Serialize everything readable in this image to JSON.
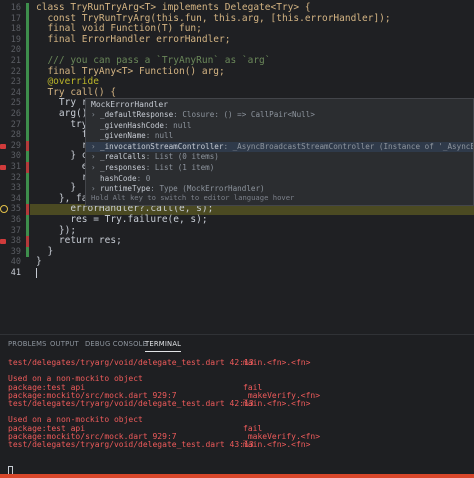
{
  "editor": {
    "lines": [
      {
        "n": "16",
        "text": "class TryRunTryArg<T> implements Delegate<Try> {"
      },
      {
        "n": "17",
        "text": "  const TryRunTryArg(this.fun, this.arg, [this.errorHandler]);"
      },
      {
        "n": "18",
        "text": "  final void Function(T) fun;"
      },
      {
        "n": "19",
        "text": "  final ErrorHandler errorHandler;"
      },
      {
        "n": "20",
        "text": ""
      },
      {
        "n": "21",
        "text": "  /// you can pass a `TryAnyRun` as `arg`"
      },
      {
        "n": "22",
        "text": "  final TryAny<T> Function() arg;"
      },
      {
        "n": "23",
        "text": "  @override"
      },
      {
        "n": "24",
        "text": "  Try call() {"
      },
      {
        "n": "25",
        "text": "    Try re"
      },
      {
        "n": "26",
        "text": "    arg()."
      },
      {
        "n": "27",
        "text": "      try"
      },
      {
        "n": "28",
        "text": "        fu"
      },
      {
        "n": "29",
        "text": "        re"
      },
      {
        "n": "30",
        "text": "      } ca"
      },
      {
        "n": "31",
        "text": "        er"
      },
      {
        "n": "32",
        "text": "        re"
      },
      {
        "n": "33",
        "text": "      }"
      },
      {
        "n": "34",
        "text": "    }, fai"
      },
      {
        "n": "35",
        "text": "      errorHandler?.call(e, s);"
      },
      {
        "n": "36",
        "text": "      res = Try.failure(e, s);"
      },
      {
        "n": "37",
        "text": "    });"
      },
      {
        "n": "38",
        "text": "    return res;"
      },
      {
        "n": "39",
        "text": "  }"
      },
      {
        "n": "40",
        "text": "}"
      },
      {
        "n": "41",
        "text": ""
      }
    ]
  },
  "popup": {
    "title": "MockErrorHandler",
    "rows": [
      {
        "key": "_defaultResponse",
        "value": "Closure: () => CallPair<Null>",
        "arrow": true
      },
      {
        "key": "_givenHashCode",
        "value": "null",
        "arrow": false
      },
      {
        "key": "_givenName",
        "value": "null",
        "arrow": false
      },
      {
        "key": "_invocationStreamController",
        "value": "_AsyncBroadcastStreamController (Instance of '_AsyncBroadcastStreamController",
        "arrow": true
      },
      {
        "key": "_realCalls",
        "value": "List (0 items)",
        "arrow": true
      },
      {
        "key": "_responses",
        "value": "List (1 item)",
        "arrow": true
      },
      {
        "key": "hashCode",
        "value": "0",
        "arrow": false
      },
      {
        "key": "runtimeType",
        "value": "Type (MockErrorHandler)",
        "arrow": true
      }
    ],
    "hint": "Hold Alt key to switch to editor language hover"
  },
  "panel": {
    "tabs": [
      "PROBLEMS",
      "OUTPUT",
      "DEBUG CONSOLE",
      "TERMINAL"
    ],
    "active_tab": "TERMINAL",
    "terminal": [
      {
        "left": "test/delegates/tryarg/void/delegate_test.dart 42:13",
        "right": "main.<fn>.<fn>"
      },
      {
        "left": "",
        "right": ""
      },
      {
        "left": "Used on a non-mockito object",
        "right": ""
      },
      {
        "left": "package:test api",
        "right": "fail"
      },
      {
        "left": "package:mockito/src/mock.dart 929:7",
        "right": "_makeVerify.<fn>"
      },
      {
        "left": "test/delegates/tryarg/void/delegate_test.dart 42:13",
        "right": "main.<fn>.<fn>"
      },
      {
        "left": "",
        "right": ""
      },
      {
        "left": "Used on a non-mockito object",
        "right": ""
      },
      {
        "left": "package:test api",
        "right": "fail"
      },
      {
        "left": "package:mockito/src/mock.dart 929:7",
        "right": "_makeVerify.<fn>"
      },
      {
        "left": "test/delegates/tryarg/void/delegate_test.dart 43:13",
        "right": "main.<fn>.<fn>"
      }
    ]
  },
  "colors": {
    "terminal_error": "#ef5b5b",
    "status_bar": "#d9472b",
    "exec_line": "#4b4a22",
    "breakpoint": "#d03b3b"
  }
}
